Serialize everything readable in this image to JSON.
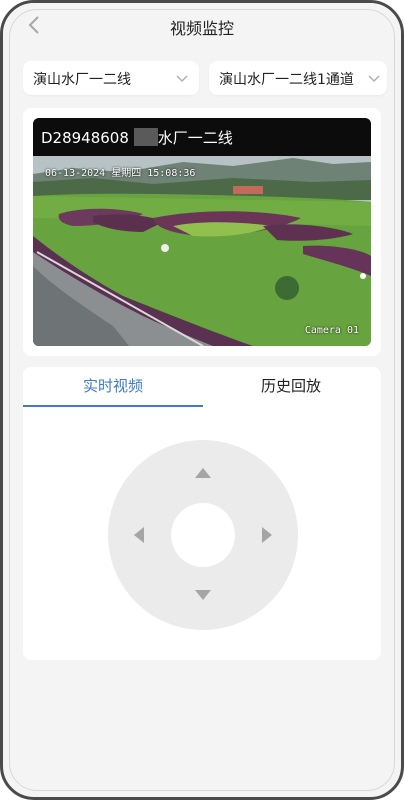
{
  "header": {
    "title": "视频监控",
    "back_icon": "chevron-left-icon"
  },
  "filters": {
    "station": "演山水厂一二线",
    "channel": "演山水厂一二线1通道",
    "dropdown_icon": "chevron-down-icon"
  },
  "video": {
    "name_prefix": "D28948608",
    "name_suffix": "水厂一二线",
    "osd_datetime": "06-13-2024 星期四 15:08:36",
    "osd_camera": "Camera 01"
  },
  "tabs": [
    {
      "label": "实时视频",
      "active": true
    },
    {
      "label": "历史回放",
      "active": false
    }
  ],
  "ptz": {
    "up_icon": "arrow-up-icon",
    "down_icon": "arrow-down-icon",
    "left_icon": "arrow-left-icon",
    "right_icon": "arrow-right-icon"
  },
  "colors": {
    "accent": "#3d7cc9",
    "background": "#f4f4f4",
    "card": "#ffffff",
    "ptz_ring": "#ebebeb",
    "ptz_arrow": "#a5a5a5"
  }
}
